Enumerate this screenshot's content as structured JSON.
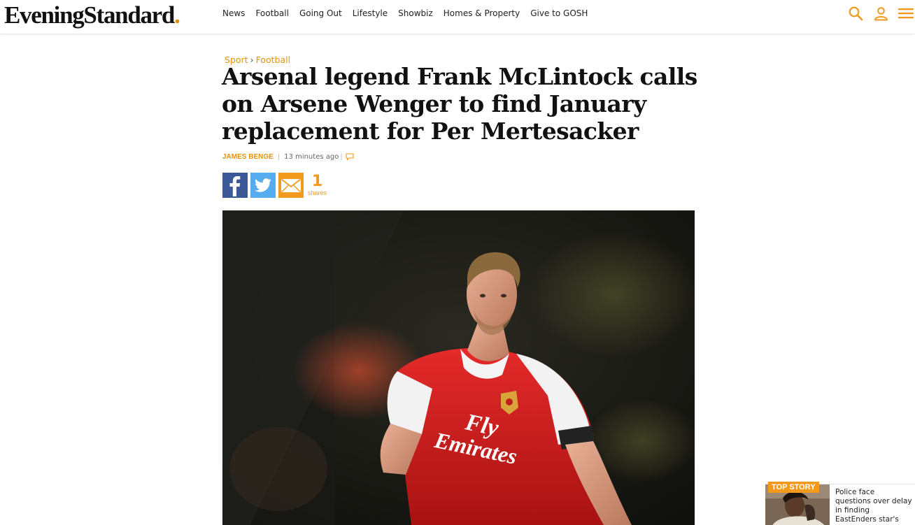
{
  "header": {
    "logo_main": "EveningStandard",
    "logo_dot": ".",
    "nav": [
      "News",
      "Football",
      "Going Out",
      "Lifestyle",
      "Showbiz",
      "Homes & Property",
      "Give to GOSH"
    ],
    "icons": [
      "search-icon",
      "user-icon",
      "menu-icon"
    ],
    "accent_color": "#f29a1d"
  },
  "article": {
    "breadcrumb": [
      "Sport",
      "Football"
    ],
    "breadcrumb_sep": "›",
    "headline": "Arsenal legend Frank McLintock calls on Arsene Wenger to find January replacement for Per Mertesacker",
    "author": "JAMES BENGE",
    "timestamp": "13 minutes  ago",
    "share_count": "1",
    "share_label": "shares",
    "share_buttons": [
      "facebook-icon",
      "twitter-icon",
      "email-icon"
    ]
  },
  "top_story": {
    "badge": "TOP STORY",
    "text": "Police face questions over delay in finding EastEnders star's body"
  }
}
